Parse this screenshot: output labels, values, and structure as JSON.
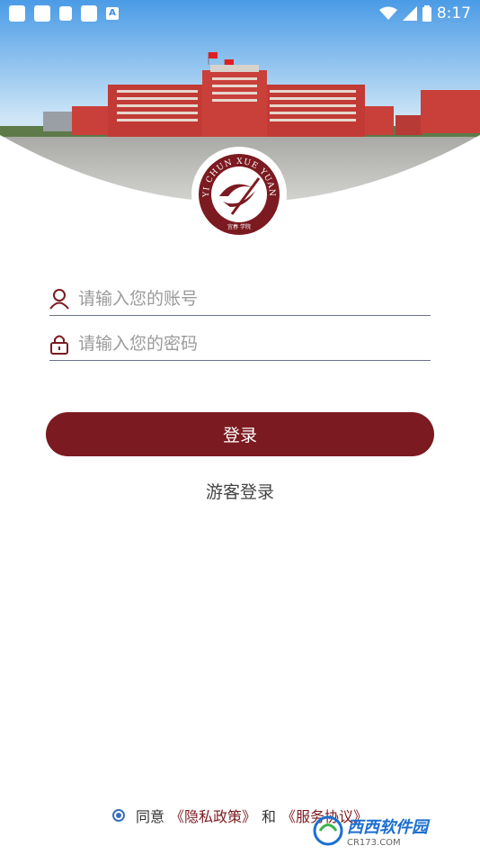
{
  "status_bar": {
    "time": "8:17"
  },
  "logo": {
    "ring_text": "YI CHUN XUE YUAN",
    "bottom_text": "宜春 学院"
  },
  "login": {
    "account_placeholder": "请输入您的账号",
    "password_placeholder": "请输入您的密码",
    "login_label": "登录",
    "guest_label": "游客登录"
  },
  "agreement": {
    "prefix": "同意",
    "privacy_link": "《隐私政策》",
    "and": "和",
    "service_link": "《服务协议》"
  },
  "watermark": {
    "title": "西西软件园",
    "sub": "CR173.COM"
  },
  "colors": {
    "accent": "#7b1a20",
    "radio": "#3a6fb7"
  }
}
